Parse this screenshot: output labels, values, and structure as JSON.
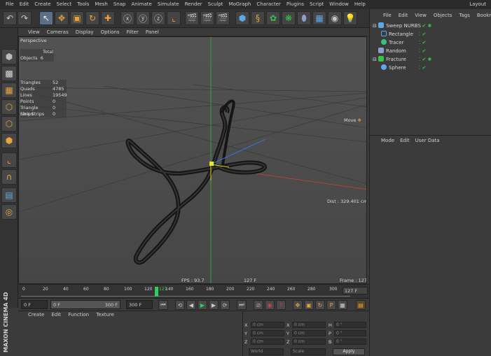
{
  "menubar": {
    "items": [
      "File",
      "Edit",
      "Create",
      "Select",
      "Tools",
      "Mesh",
      "Snap",
      "Animate",
      "Simulate",
      "Render",
      "Sculpt",
      "MoGraph",
      "Character",
      "Plugins",
      "Script",
      "Window",
      "Help"
    ],
    "layout_label": "Layout"
  },
  "viewport": {
    "menu": [
      "View",
      "Cameras",
      "Display",
      "Options",
      "Filter",
      "Panel"
    ],
    "name": "Perspective",
    "total_header": "Total",
    "objects_label": "Objects",
    "objects_value": "6",
    "stats": [
      {
        "label": "Triangles",
        "value": "52"
      },
      {
        "label": "Quads",
        "value": "4785"
      },
      {
        "label": "Lines",
        "value": "19549"
      },
      {
        "label": "Points",
        "value": "0"
      },
      {
        "label": "Triangle Strips",
        "value": "0"
      },
      {
        "label": "Line Strips",
        "value": "0"
      }
    ],
    "move_label": "Move",
    "dist": "Dist : 329.401 cm",
    "fps": "FPS : 93.7",
    "frame_small": "127 F",
    "frame": "Frame : 127"
  },
  "timeline": {
    "ticks": [
      "0",
      "20",
      "40",
      "60",
      "80",
      "100",
      "120",
      "140",
      "160",
      "180",
      "200",
      "220",
      "240",
      "260",
      "280",
      "300"
    ],
    "current": "127",
    "end_field": "127 F"
  },
  "transport": {
    "start_field": "0 F",
    "min_field": "0 F",
    "max_field": "300 F",
    "end_field": "300 F"
  },
  "material_manager": {
    "menu": [
      "Create",
      "Edit",
      "Function",
      "Texture"
    ]
  },
  "coordinates": {
    "rows": [
      {
        "axis": "X",
        "pos": "0 cm",
        "size": "0 cm",
        "rot_label": "H",
        "rot": "0 °"
      },
      {
        "axis": "Y",
        "pos": "0 cm",
        "size": "0 cm",
        "rot_label": "P",
        "rot": "0 °"
      },
      {
        "axis": "Z",
        "pos": "0 cm",
        "size": "0 cm",
        "rot_label": "B",
        "rot": "0 °"
      }
    ],
    "world_label": "World",
    "scale_label": "Scale",
    "apply_label": "Apply"
  },
  "object_manager": {
    "menu": [
      "File",
      "Edit",
      "View",
      "Objects",
      "Tags",
      "Bookmarks"
    ],
    "objects": [
      {
        "name": "Sweep NURBS",
        "color": "#5fa8e8"
      },
      {
        "name": "Rectangle",
        "color": "#5fa8e8"
      },
      {
        "name": "Tracer",
        "color": "#39c27a"
      },
      {
        "name": "Random",
        "color": "#8e9ecf"
      },
      {
        "name": "Fracture",
        "color": "#39c24a"
      },
      {
        "name": "Sphere",
        "color": "#5fa8e8"
      }
    ]
  },
  "attribute_manager": {
    "menu": [
      "Mode",
      "Edit",
      "User Data"
    ]
  },
  "branding": {
    "logo_text": "MAXON CINEMA 4D"
  },
  "colors": {
    "axis_x": "#c83c3c",
    "axis_y": "#3cb43c",
    "axis_z": "#3c6fd8",
    "accent": "#e8a33c",
    "playhead": "#2fcf5f"
  }
}
